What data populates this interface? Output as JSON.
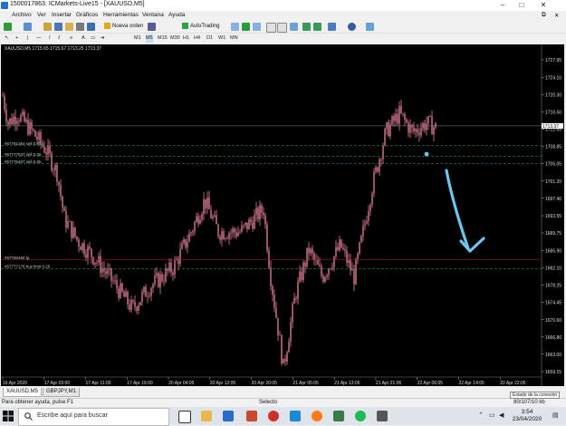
{
  "window": {
    "title": "1500017863: ICMarkets-Live15 - [XAUUSD,M5]",
    "minimize": "–",
    "restore": "□",
    "close": "✕"
  },
  "menu": [
    "Archivo",
    "Ver",
    "Insertar",
    "Gráficos",
    "Herramientas",
    "Ventana",
    "Ayuda"
  ],
  "toolbar": {
    "new_order": "Nueva orden",
    "autotrading": "AutoTrading"
  },
  "timeframes": [
    "M1",
    "M5",
    "M15",
    "M30",
    "H1",
    "H4",
    "D1",
    "W1",
    "MN"
  ],
  "active_timeframe": "M5",
  "chart": {
    "header": "XAUUSD,M5  1715.65 1715.67 1713.25 1713.37",
    "current_price": "1713.37",
    "price_ticks": [
      "1727.95",
      "1724.10",
      "1720.30",
      "1716.50",
      "1712.65",
      "1708.85",
      "1705.05",
      "1701.20",
      "1697.40",
      "1693.55",
      "1689.75",
      "1685.90",
      "1682.10",
      "1678.25",
      "1674.45",
      "1670.60",
      "1666.80",
      "1663.00",
      "1659.15"
    ],
    "time_ticks": [
      "16 Apr 2020",
      "17 Apr 03:00",
      "17 Apr 11:00",
      "17 Apr 19:00",
      "20 Apr 04:05",
      "20 Apr 12:05",
      "20 Apr 20:05",
      "21 Apr 05:05",
      "21 Apr 13:05",
      "21 Apr 21:05",
      "22 Apr 06:05",
      "22 Apr 14:05",
      "22 Apr 22:05"
    ],
    "order_labels": [
      "#57781364 sell 0.05",
      "#57777037 sell 0.05",
      "#57776407 sell 0.05",
      "#57780490 tp",
      "#57777176 buy limit 0.25"
    ],
    "colors": {
      "background": "#000000",
      "candle": "#ff8fa8",
      "order_line": "#3aa05a",
      "tp_line": "#b02020",
      "annotation": "#6ec6ee"
    }
  },
  "symbol_tabs": [
    "XAUUSD,M5",
    "GBPJPY,M1"
  ],
  "status": {
    "help": "Para obtener ayuda, pulse F1",
    "profile": "Selecto",
    "traffic": "80/107/10 kb",
    "tooltip": "Estado de la conexión"
  },
  "taskbar": {
    "search_placeholder": "Escribe aquí para buscar",
    "time": "3:54",
    "date": "23/04/2020"
  }
}
